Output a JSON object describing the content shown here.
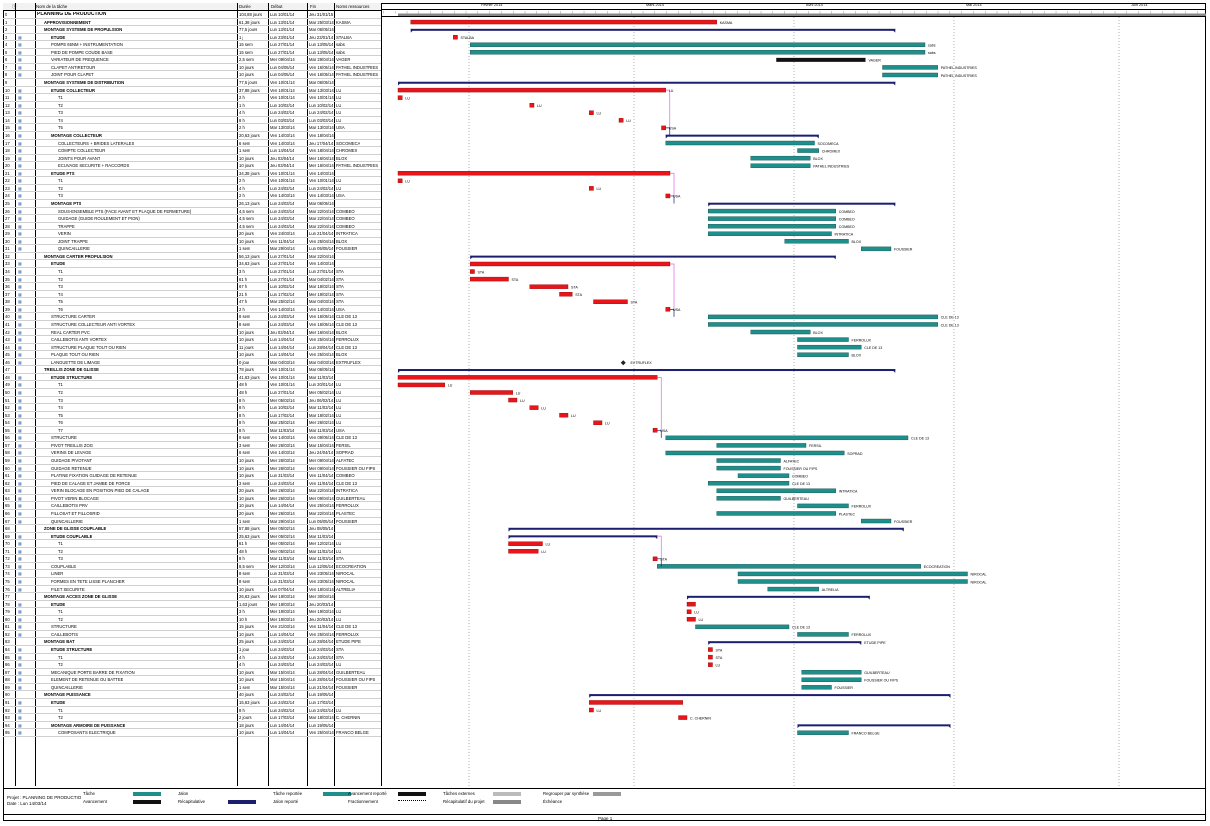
{
  "header": {
    "id_col": "",
    "info_col": "",
    "name_col": "Nom de la tâche",
    "duration_col": "Durée",
    "start_col": "Début",
    "end_col": "Fin",
    "resources_col": "Noms ressources"
  },
  "timeline": {
    "months": [
      "Février 2014",
      "Mars 2014",
      "Avril 2014",
      "Mai 2014",
      "Juin 2014"
    ]
  },
  "colors": {
    "normal_task": "#1f8f8c",
    "critical_task": "#e8151b",
    "summary": "#1b1f6e",
    "link_normal": "#1b1f6e",
    "link_critical": "#e8151b",
    "link_pink": "#e066e0",
    "black_bar": "#111111"
  },
  "tasks": [
    {
      "id": "0",
      "name": "PLANNING DE PRODUCTION",
      "duration": "104,88 jours",
      "start": "Lun 10/01/14",
      "end": "Jeu 31/01/15",
      "res": "",
      "level": 0
    },
    {
      "id": "1",
      "name": "APPROVISIONNEMENT",
      "duration": "61,38 jours",
      "start": "Lun 13/01/14",
      "end": "Mar 25/03/14",
      "res": "KASMA",
      "level": 1
    },
    {
      "id": "2",
      "name": "MONTAGE SYSTEME DE PROPULSION",
      "duration": "77,5 jours",
      "start": "Lun 13/01/14",
      "end": "Mar 06/05/14",
      "res": "",
      "level": 1
    },
    {
      "id": "3",
      "name": "ETUDE",
      "duration": "1 j",
      "start": "Lun 23/01/14",
      "end": "Jeu 23/01/14",
      "res": "STALBA",
      "level": 2
    },
    {
      "id": "4",
      "name": "POMPE 65NM + INSTRUMENTATION",
      "duration": "15 sem",
      "start": "Lun 27/01/14",
      "end": "Lun 13/05/14",
      "res": "sabs",
      "level": 2
    },
    {
      "id": "5",
      "name": "PIED DE POMPE COUDE BASE",
      "duration": "15 sem",
      "start": "Lun 27/01/14",
      "end": "Lun 13/05/14",
      "res": "sabs",
      "level": 2
    },
    {
      "id": "6",
      "name": "VARIATEUR DE FREQUENCE",
      "duration": "2,5 sem",
      "start": "Mer 09/04/14",
      "end": "Mar 29/04/14",
      "res": "VAGER",
      "level": 2
    },
    {
      "id": "7",
      "name": "CLAPET ANTIRETOUR",
      "duration": "10 jours",
      "start": "Lun 04/05/14",
      "end": "Ven 16/05/14",
      "res": "PATHEL INDUSTRIES",
      "level": 2
    },
    {
      "id": "8",
      "name": "JOINT POUR CLAPET",
      "duration": "10 jours",
      "start": "Lun 04/05/14",
      "end": "Ven 16/05/14",
      "res": "PATHEL INDUSTRIES",
      "level": 2
    },
    {
      "id": "9",
      "name": "MONTAGE SYSTEME DE DISTRIBUTION",
      "duration": "77,5 jours",
      "start": "Ven 10/01/14",
      "end": "Mar 06/05/14",
      "res": "",
      "level": 1
    },
    {
      "id": "10",
      "name": "ETUDE COLLECTEUR",
      "duration": "37,88 jours",
      "start": "Ven 10/01/14",
      "end": "Mar 13/03/14",
      "res": "LU",
      "level": 2
    },
    {
      "id": "11",
      "name": "T1",
      "duration": "2 h",
      "start": "Ven 10/01/14",
      "end": "Ven 10/01/14",
      "res": "LU",
      "level": 3
    },
    {
      "id": "12",
      "name": "T2",
      "duration": "1 h",
      "start": "Lun 10/02/14",
      "end": "Lun 10/02/14",
      "res": "LU",
      "level": 3
    },
    {
      "id": "13",
      "name": "T3",
      "duration": "4 h",
      "start": "Lun 24/02/14",
      "end": "Lun 24/02/14",
      "res": "LU",
      "level": 3
    },
    {
      "id": "14",
      "name": "T4",
      "duration": "8 h",
      "start": "Lun 03/03/14",
      "end": "Lun 03/03/14",
      "res": "LU",
      "level": 3
    },
    {
      "id": "15",
      "name": "T5",
      "duration": "2 h",
      "start": "Mar 13/03/14",
      "end": "Mar 13/03/14",
      "res": "USA",
      "level": 3
    },
    {
      "id": "16",
      "name": "MONTAGE COLLECTEUR",
      "duration": "20,63 jours",
      "start": "Ven 14/03/14",
      "end": "Ven 18/04/14",
      "res": "",
      "level": 2
    },
    {
      "id": "17",
      "name": "COLLECTEURS + BRIDES LATERALES",
      "duration": "6 sem",
      "start": "Ven 14/03/14",
      "end": "Jeu 17/04/14",
      "res": "SOCOMECA",
      "level": 3
    },
    {
      "id": "18",
      "name": "COMPTE COLLECTEUR",
      "duration": "1 sem",
      "start": "Lun 14/04/14",
      "end": "Ven 18/04/14",
      "res": "CHROMEX",
      "level": 3
    },
    {
      "id": "19",
      "name": "JOINTS POUR AVANT",
      "duration": "10 jours",
      "start": "Jeu 03/04/14",
      "end": "Mer 16/04/14",
      "res": "BLOX",
      "level": 3
    },
    {
      "id": "20",
      "name": "ECUVAGE SECURITE + RACCORDS",
      "duration": "10 jours",
      "start": "Jeu 03/04/14",
      "end": "Mer 16/04/14",
      "res": "PATHEL INDUSTRIES",
      "level": 3
    },
    {
      "id": "21",
      "name": "ETUDE PTS",
      "duration": "34,38 jours",
      "start": "Ven 10/01/14",
      "end": "Ven 14/03/14",
      "res": "",
      "level": 2
    },
    {
      "id": "22",
      "name": "T1",
      "duration": "2 h",
      "start": "Ven 10/01/14",
      "end": "Ven 10/01/14",
      "res": "LU",
      "level": 3
    },
    {
      "id": "23",
      "name": "T2",
      "duration": "4 h",
      "start": "Lun 24/02/14",
      "end": "Lun 24/02/14",
      "res": "LU",
      "level": 3
    },
    {
      "id": "24",
      "name": "T3",
      "duration": "2 h",
      "start": "Ven 14/03/14",
      "end": "Ven 14/03/14",
      "res": "USA",
      "level": 3
    },
    {
      "id": "25",
      "name": "MONTAGE PTS",
      "duration": "26,13 jours",
      "start": "Lun 24/03/14",
      "end": "Mar 06/05/14",
      "res": "",
      "level": 2
    },
    {
      "id": "26",
      "name": "SOUS-ENSEMBLE PTS (FACE AVANT ET PLAQUE DE FERMETURE)",
      "duration": "4,5 sem",
      "start": "Lun 24/03/14",
      "end": "Mar 22/04/14",
      "res": "COMBEO",
      "level": 3
    },
    {
      "id": "27",
      "name": "GUIDAGE (GUIDE ROULEMENT ET PION)",
      "duration": "4,5 sem",
      "start": "Lun 24/03/14",
      "end": "Mar 22/04/14",
      "res": "COMBEO",
      "level": 3
    },
    {
      "id": "28",
      "name": "TRAPPE",
      "duration": "4,5 sem",
      "start": "Lun 24/03/14",
      "end": "Mar 22/04/14",
      "res": "COMBEO",
      "level": 3
    },
    {
      "id": "29",
      "name": "VERIN",
      "duration": "20 jours",
      "start": "Ven 24/03/14",
      "end": "Lun 21/04/14",
      "res": "INTRATICA",
      "level": 3
    },
    {
      "id": "30",
      "name": "JOINT TRAPPE",
      "duration": "10 jours",
      "start": "Ven 11/04/14",
      "end": "Ven 25/04/14",
      "res": "BLOX",
      "level": 3
    },
    {
      "id": "31",
      "name": "QUINCAILLERIE",
      "duration": "1 sem",
      "start": "Mar 29/04/14",
      "end": "Lun 05/05/14",
      "res": "FOUSSIER",
      "level": 3
    },
    {
      "id": "32",
      "name": "MONTAGE CARTER PROPULSION",
      "duration": "56,13 jours",
      "start": "Lun 27/01/14",
      "end": "Mar 22/04/14",
      "res": "",
      "level": 1
    },
    {
      "id": "33",
      "name": "ETUDE",
      "duration": "34,63 jours",
      "start": "Lun 27/01/14",
      "end": "Ven 14/03/14",
      "res": "",
      "level": 2
    },
    {
      "id": "34",
      "name": "T1",
      "duration": "3 h",
      "start": "Lun 27/01/14",
      "end": "Lun 27/01/14",
      "res": "STA",
      "level": 3
    },
    {
      "id": "35",
      "name": "T2",
      "duration": "61 h",
      "start": "Lun 27/01/14",
      "end": "Mar 04/02/14",
      "res": "STA",
      "level": 3
    },
    {
      "id": "36",
      "name": "T3",
      "duration": "67 h",
      "start": "Lun 10/02/14",
      "end": "Mar 18/02/14",
      "res": "STA",
      "level": 3
    },
    {
      "id": "37",
      "name": "T4",
      "duration": "21 h",
      "start": "Lun 17/02/14",
      "end": "Mer 19/02/14",
      "res": "STA",
      "level": 3
    },
    {
      "id": "38",
      "name": "T5",
      "duration": "47 h",
      "start": "Mar 25/02/14",
      "end": "Mar 04/03/14",
      "res": "STA",
      "level": 3
    },
    {
      "id": "39",
      "name": "T6",
      "duration": "2 h",
      "start": "Ven 14/03/14",
      "end": "Ven 14/03/14",
      "res": "USA",
      "level": 3
    },
    {
      "id": "40",
      "name": "STRUCTURE CARTER",
      "duration": "8 sem",
      "start": "Lun 24/03/14",
      "end": "Ven 16/05/14",
      "res": "CLE DE 13",
      "level": 2
    },
    {
      "id": "41",
      "name": "STRUCTURE COLLECTEUR ANTI VORTEX",
      "duration": "8 sem",
      "start": "Lun 24/03/14",
      "end": "Ven 16/05/14",
      "res": "CLE DE 13",
      "level": 2
    },
    {
      "id": "42",
      "name": "REAL CARTER PVC",
      "duration": "10 jours",
      "start": "Jeu 03/04/14",
      "end": "Mer 16/04/14",
      "res": "BLOX",
      "level": 2
    },
    {
      "id": "43",
      "name": "CAILLEBOTIS ANTI VORTEX",
      "duration": "10 jours",
      "start": "Lun 14/04/14",
      "end": "Ven 25/04/14",
      "res": "FERROLUX",
      "level": 2
    },
    {
      "id": "44",
      "name": "STRUCTURE PLAQUE TOUT OU RIEN",
      "duration": "11 jours",
      "start": "Lun 14/04/14",
      "end": "Lun 28/04/14",
      "res": "CLE DE 13",
      "level": 2
    },
    {
      "id": "45",
      "name": "PLAQUE TOUT OU RIEN",
      "duration": "10 jours",
      "start": "Lun 14/04/14",
      "end": "Ven 25/04/14",
      "res": "BLOX",
      "level": 2
    },
    {
      "id": "46",
      "name": "LANGUETTE DE LIMAGE",
      "duration": "0 jour",
      "start": "Mar 04/03/14",
      "end": "Mar 04/03/14",
      "res": "EXTRUFLEX",
      "level": 2
    },
    {
      "id": "47",
      "name": "TREILLIS ZONE DE GLISSE",
      "duration": "78 jours",
      "start": "Ven 10/01/14",
      "end": "Mar 06/05/14",
      "res": "",
      "level": 1
    },
    {
      "id": "48",
      "name": "ETUDE STRUCTURE",
      "duration": "41,63 jours",
      "start": "Ven 10/01/14",
      "end": "Mar 11/03/14",
      "res": "",
      "level": 2
    },
    {
      "id": "49",
      "name": "T1",
      "duration": "48 h",
      "start": "Ven 10/01/14",
      "end": "Lun 20/01/14",
      "res": "LU",
      "level": 3
    },
    {
      "id": "50",
      "name": "T2",
      "duration": "48 h",
      "start": "Lun 27/01/14",
      "end": "Mer 05/02/14",
      "res": "LU",
      "level": 3
    },
    {
      "id": "51",
      "name": "T3",
      "duration": "8 h",
      "start": "Mer 05/02/14",
      "end": "Jeu 06/02/14",
      "res": "LU",
      "level": 3
    },
    {
      "id": "52",
      "name": "T4",
      "duration": "8 h",
      "start": "Lun 10/02/14",
      "end": "Mar 11/02/14",
      "res": "LU",
      "level": 3
    },
    {
      "id": "53",
      "name": "T5",
      "duration": "8 h",
      "start": "Lun 17/02/14",
      "end": "Mar 18/02/14",
      "res": "LU",
      "level": 3
    },
    {
      "id": "54",
      "name": "T6",
      "duration": "8 h",
      "start": "Mar 25/02/14",
      "end": "Mer 26/02/14",
      "res": "LU",
      "level": 3
    },
    {
      "id": "55",
      "name": "T7",
      "duration": "8 h",
      "start": "Mar 11/03/14",
      "end": "Mar 11/03/14",
      "res": "USA",
      "level": 3
    },
    {
      "id": "56",
      "name": "STRUCTURE",
      "duration": "8 sem",
      "start": "Ven 14/03/14",
      "end": "Ven 09/05/14",
      "res": "CLE DE 13",
      "level": 2
    },
    {
      "id": "57",
      "name": "PIVOT TREILLIS ZOG",
      "duration": "3 sem",
      "start": "Mer 26/03/14",
      "end": "Mar 15/04/14",
      "res": "FERSIL",
      "level": 2
    },
    {
      "id": "58",
      "name": "VERINS DE LEVAGE",
      "duration": "6 sem",
      "start": "Ven 14/03/14",
      "end": "Jeu 24/04/14",
      "res": "SOPRAD",
      "level": 2
    },
    {
      "id": "59",
      "name": "GUIDAGE PIVOTANT",
      "duration": "10 jours",
      "start": "Mer 26/03/14",
      "end": "Mer 09/04/14",
      "res": "ALFATEC",
      "level": 2
    },
    {
      "id": "60",
      "name": "GUIDAGE RETENUE",
      "duration": "10 jours",
      "start": "Mer 26/03/14",
      "end": "Mer 09/04/14",
      "res": "FOUSSIER OU FIPS",
      "level": 2
    },
    {
      "id": "61",
      "name": "PLATINE FIXATION GUIDAGE DE RETENUE",
      "duration": "10 jours",
      "start": "Lun 31/03/14",
      "end": "Ven 11/04/14",
      "res": "COMBEO",
      "level": 2
    },
    {
      "id": "62",
      "name": "PIED DE CALAGE ET JAMBE DE FORCE",
      "duration": "3 sem",
      "start": "Lun 24/03/14",
      "end": "Ven 11/04/14",
      "res": "CLE DE 13",
      "level": 2
    },
    {
      "id": "63",
      "name": "VERIN BLOCAGE EN POSITION PIED DE CALAGE",
      "duration": "20 jours",
      "start": "Mer 26/03/14",
      "end": "Mar 22/04/14",
      "res": "INTRATICA",
      "level": 2
    },
    {
      "id": "64",
      "name": "PIVOT VERIN BLOCAGE",
      "duration": "10 jours",
      "start": "Mer 26/03/14",
      "end": "Mer 09/04/14",
      "res": "GUILBERTEAU",
      "level": 2
    },
    {
      "id": "65",
      "name": "CAILLEBOTIS PRV",
      "duration": "10 jours",
      "start": "Lun 14/04/14",
      "end": "Ven 25/04/14",
      "res": "FERROLUX",
      "level": 2
    },
    {
      "id": "66",
      "name": "FILLOSAT ET FILLOSRID",
      "duration": "20 jours",
      "start": "Mer 26/03/14",
      "end": "Mar 22/04/14",
      "res": "PLASTEC",
      "level": 2
    },
    {
      "id": "67",
      "name": "QUINCAILLERIE",
      "duration": "1 sem",
      "start": "Mar 29/04/14",
      "end": "Lun 05/05/14",
      "res": "FOUSSIER",
      "level": 2
    },
    {
      "id": "68",
      "name": "ZONE DE GLISSE COUPLABLE",
      "duration": "57,88 jours",
      "start": "Mer 05/02/14",
      "end": "Jeu 08/05/14",
      "res": "",
      "level": 1
    },
    {
      "id": "69",
      "name": "ETUDE COUPLABLE",
      "duration": "25,63 jours",
      "start": "Mer 05/02/14",
      "end": "Mar 11/03/14",
      "res": "",
      "level": 2
    },
    {
      "id": "70",
      "name": "T1",
      "duration": "61 h",
      "start": "Mer 05/02/14",
      "end": "Mer 12/02/14",
      "res": "LU",
      "level": 3
    },
    {
      "id": "71",
      "name": "T2",
      "duration": "48 h",
      "start": "Mer 05/02/14",
      "end": "Mar 11/02/14",
      "res": "LU",
      "level": 3
    },
    {
      "id": "72",
      "name": "T3",
      "duration": "8 h",
      "start": "Mar 11/03/14",
      "end": "Mar 11/03/14",
      "res": "STA",
      "level": 3
    },
    {
      "id": "73",
      "name": "COUPLABLE",
      "duration": "8,5 sem",
      "start": "Mer 12/03/14",
      "end": "Lun 12/05/14",
      "res": "ECOCREATION",
      "level": 2
    },
    {
      "id": "74",
      "name": "LINER",
      "duration": "8 sem",
      "start": "Lun 31/03/14",
      "end": "Ven 23/05/14",
      "res": "NIROCAL",
      "level": 2
    },
    {
      "id": "75",
      "name": "FORMES EN TETE LISSE PLANCHER",
      "duration": "8 sem",
      "start": "Lun 31/03/14",
      "end": "Ven 23/05/14",
      "res": "NIROCAL",
      "level": 2
    },
    {
      "id": "76",
      "name": "FILET SECURITE",
      "duration": "10 jours",
      "start": "Lun 07/04/14",
      "end": "Ven 18/04/14",
      "res": "ALTRELIA",
      "level": 2
    },
    {
      "id": "77",
      "name": "MONTAGE ACCES ZONE DE GLISSE",
      "duration": "26,63 jours",
      "start": "Mer 19/03/14",
      "end": "Mer 30/04/14",
      "res": "",
      "level": 1
    },
    {
      "id": "78",
      "name": "ETUDE",
      "duration": "1,63 jours",
      "start": "Mer 19/03/14",
      "end": "Jeu 20/03/14",
      "res": "",
      "level": 2
    },
    {
      "id": "79",
      "name": "T1",
      "duration": "3 h",
      "start": "Mer 19/03/14",
      "end": "Mer 19/03/14",
      "res": "LU",
      "level": 3
    },
    {
      "id": "80",
      "name": "T2",
      "duration": "10 h",
      "start": "Mer 19/03/14",
      "end": "Jeu 20/03/14",
      "res": "LU",
      "level": 3
    },
    {
      "id": "81",
      "name": "STRUCTURE",
      "duration": "15 jours",
      "start": "Ven 21/03/14",
      "end": "Ven 11/04/14",
      "res": "CLE DE 13",
      "level": 2
    },
    {
      "id": "82",
      "name": "CAILLEBOTIS",
      "duration": "10 jours",
      "start": "Lun 14/04/14",
      "end": "Ven 25/04/14",
      "res": "FERROLUX",
      "level": 2
    },
    {
      "id": "83",
      "name": "MONTAGE BAT",
      "duration": "25 jours",
      "start": "Lun 24/03/14",
      "end": "Lun 28/04/14",
      "res": "ETUDE PIPE",
      "level": 1
    },
    {
      "id": "84",
      "name": "ETUDE STRUCTURE",
      "duration": "1 jour",
      "start": "Lun 24/03/14",
      "end": "Lun 24/03/14",
      "res": "STA",
      "level": 2
    },
    {
      "id": "85",
      "name": "T1",
      "duration": "4 h",
      "start": "Lun 24/03/14",
      "end": "Lun 24/03/14",
      "res": "STA",
      "level": 3
    },
    {
      "id": "86",
      "name": "T2",
      "duration": "4 h",
      "start": "Lun 24/03/14",
      "end": "Lun 24/03/14",
      "res": "LU",
      "level": 3
    },
    {
      "id": "87",
      "name": "MECANIQUE PORTE BARRE DE FIXATION",
      "duration": "10 jours",
      "start": "Mar 15/04/14",
      "end": "Lun 28/04/14",
      "res": "GUILBERTEAU",
      "level": 2
    },
    {
      "id": "88",
      "name": "ELEMENT DE RETENUE OU BATTEE",
      "duration": "10 jours",
      "start": "Mar 15/04/14",
      "end": "Lun 28/04/14",
      "res": "FOUSSIER OU FIPS",
      "level": 2
    },
    {
      "id": "89",
      "name": "QUINCAILLERIE",
      "duration": "1 sem",
      "start": "Mar 15/04/14",
      "end": "Lun 21/04/14",
      "res": "FOUSSIER",
      "level": 2
    },
    {
      "id": "90",
      "name": "MONTAGE PUISSANCE",
      "duration": "40 jours",
      "start": "Lun 24/02/14",
      "end": "Lun 19/05/14",
      "res": "",
      "level": 1
    },
    {
      "id": "91",
      "name": "ETUDE",
      "duration": "15,63 jours",
      "start": "Lun 24/02/14",
      "end": "Lun 17/03/14",
      "res": "",
      "level": 2
    },
    {
      "id": "92",
      "name": "T1",
      "duration": "8 h",
      "start": "Lun 24/02/14",
      "end": "Lun 24/02/14",
      "res": "LU",
      "level": 3
    },
    {
      "id": "93",
      "name": "T2",
      "duration": "2 jours",
      "start": "Lun 17/03/14",
      "end": "Mar 18/03/14",
      "res": "C. CHERNIN",
      "level": 3
    },
    {
      "id": "94",
      "name": "MONTAGE ARMOIRE DE PUISSANCE",
      "duration": "18 jours",
      "start": "Lun 14/04/14",
      "end": "Lun 19/05/14",
      "res": "",
      "level": 2
    },
    {
      "id": "95",
      "name": "COMPOSANTS ELECTRIQUE",
      "duration": "10 jours",
      "start": "Lun 14/04/14",
      "end": "Ven 25/04/14",
      "res": "FRANCO BELGE",
      "level": 3
    }
  ],
  "legend": {
    "project_label": "Projet : PLANNING DE PRODUCTIO",
    "date_label": "Date : Lun 14/03/14",
    "items": [
      {
        "label": "Tâche",
        "kind": "task"
      },
      {
        "label": "Avancement",
        "kind": "progress"
      },
      {
        "label": "Jalon",
        "kind": "milestone"
      },
      {
        "label": "Récapitulative",
        "kind": "summary"
      },
      {
        "label": "Tâche reportée",
        "kind": "split"
      },
      {
        "label": "Jalon reporté",
        "kind": "milestone_late"
      },
      {
        "label": "Avancement reporté",
        "kind": "deadline"
      },
      {
        "label": "Fractionnement",
        "kind": "split_dots"
      },
      {
        "label": "Tâches externes",
        "kind": "external"
      },
      {
        "label": "Récapitulatif du projet",
        "kind": "project_summary"
      },
      {
        "label": "Regrouper par synthèse",
        "kind": "group"
      },
      {
        "label": "Échéance",
        "kind": "deadline_marker"
      }
    ]
  },
  "footer": {
    "page": "Page 1"
  }
}
